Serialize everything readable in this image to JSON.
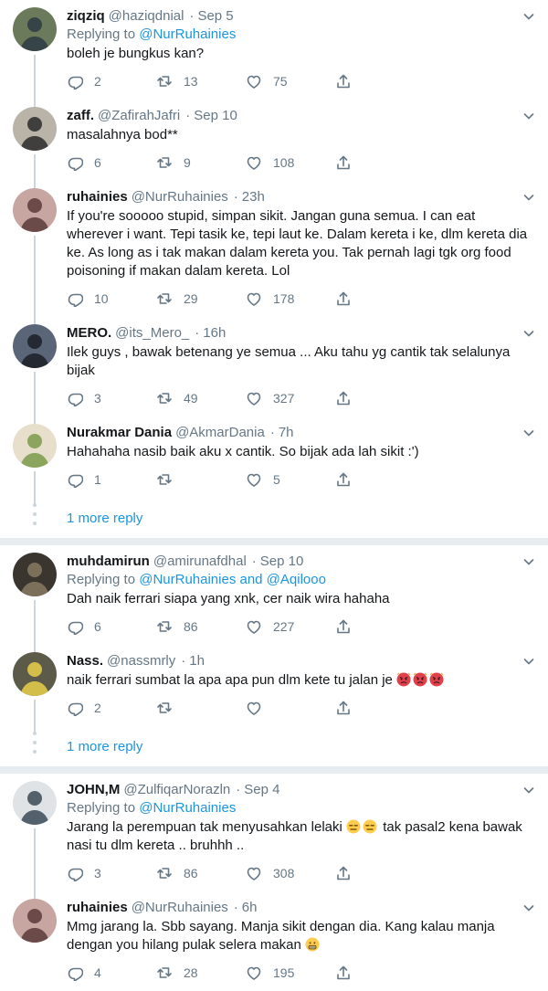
{
  "threads": [
    {
      "tweets": [
        {
          "name": "ziqziq",
          "handle": "@haziqdnial",
          "time": "Sep 5",
          "replying_prefix": "Replying to",
          "replying_to": "@NurRuhainies",
          "text": "boleh je bungkus kan?",
          "replies": "2",
          "retweets": "13",
          "likes": "75",
          "avatar": {
            "bg": "#6b7a5a",
            "fg": "#2d3a44"
          }
        },
        {
          "name": "zaff.",
          "handle": "@ZafirahJafri",
          "time": "Sep 10",
          "text": "masalahnya bod**",
          "replies": "6",
          "retweets": "9",
          "likes": "108",
          "avatar": {
            "bg": "#b9b3a8",
            "fg": "#2a2a2a"
          }
        },
        {
          "name": "ruhainies",
          "handle": "@NurRuhainies",
          "time": "23h",
          "text": "If you're sooooo stupid, simpan sikit. Jangan guna semua. I can eat wherever i want. Tepi tasik ke, tepi laut ke. Dalam kereta i ke, dlm kereta dia ke. As long as i tak makan dalam kereta you. Tak pernah lagi tgk org food poisoning if makan dalam kereta. Lol",
          "replies": "10",
          "retweets": "29",
          "likes": "178",
          "avatar": {
            "bg": "#c7a5a0",
            "fg": "#5a3b3b"
          }
        },
        {
          "name": "MERO.",
          "handle": "@its_Mero_",
          "time": "16h",
          "text": "Ilek guys , bawak betenang ye semua ... Aku tahu yg cantik tak selalunya bijak",
          "replies": "3",
          "retweets": "49",
          "likes": "327",
          "avatar": {
            "bg": "#5a6578",
            "fg": "#1c1f26"
          }
        },
        {
          "name": "Nurakmar Dania",
          "handle": "@AkmarDania",
          "time": "7h",
          "text": "Hahahaha nasib baik aku x cantik. So bijak ada lah sikit :')",
          "replies": "1",
          "retweets": "",
          "likes": "5",
          "avatar": {
            "bg": "#e7dfcc",
            "fg": "#7a9a4a"
          }
        }
      ],
      "more_replies": "1 more reply"
    },
    {
      "tweets": [
        {
          "name": "muhdamirun",
          "handle": "@amirunafdhal",
          "time": "Sep 10",
          "replying_prefix": "Replying to",
          "replying_to": "@NurRuhainies and @Aqilooo",
          "text": "Dah naik ferrari siapa yang xnk, cer naik wira hahaha",
          "replies": "6",
          "retweets": "86",
          "likes": "227",
          "avatar": {
            "bg": "#3a352e",
            "fg": "#8a7a62"
          }
        },
        {
          "name": "Nass.",
          "handle": "@nassmrly",
          "time": "1h",
          "text": "naik ferrari sumbat la apa apa pun dlm kete tu jalan je",
          "emojis": [
            "angry-face",
            "angry-face",
            "angry-face"
          ],
          "replies": "2",
          "retweets": "",
          "likes": "",
          "avatar": {
            "bg": "#5c5a48",
            "fg": "#e8d04a"
          }
        }
      ],
      "more_replies": "1 more reply"
    },
    {
      "tweets": [
        {
          "name": "JOHN,M",
          "handle": "@ZulfiqarNorazln",
          "time": "Sep 4",
          "replying_prefix": "Replying to",
          "replying_to": "@NurRuhainies",
          "text_a": "Jarang la perempuan tak menyusahkan lelaki",
          "emojis": [
            "expressionless-face",
            "expressionless-face"
          ],
          "text_b": " tak pasal2 kena bawak nasi tu dlm kereta .. bruhhh ..",
          "replies": "3",
          "retweets": "86",
          "likes": "308",
          "avatar": {
            "bg": "#dfe3e6",
            "fg": "#3b4a56"
          }
        },
        {
          "name": "ruhainies",
          "handle": "@NurRuhainies",
          "time": "6h",
          "text": "Mmg jarang la. Sbb sayang. Manja sikit dengan dia. Kang kalau manja dengan you hilang pulak selera makan",
          "emojis": [
            "grimacing-face"
          ],
          "replies": "4",
          "retweets": "28",
          "likes": "195",
          "avatar": {
            "bg": "#c7a5a0",
            "fg": "#5a3b3b"
          }
        }
      ]
    }
  ],
  "colors": {
    "link": "#1b95e0",
    "muted": "#657786",
    "text": "#14171a",
    "thread_line": "#ccd6dd",
    "separator": "#e6ecf0"
  }
}
